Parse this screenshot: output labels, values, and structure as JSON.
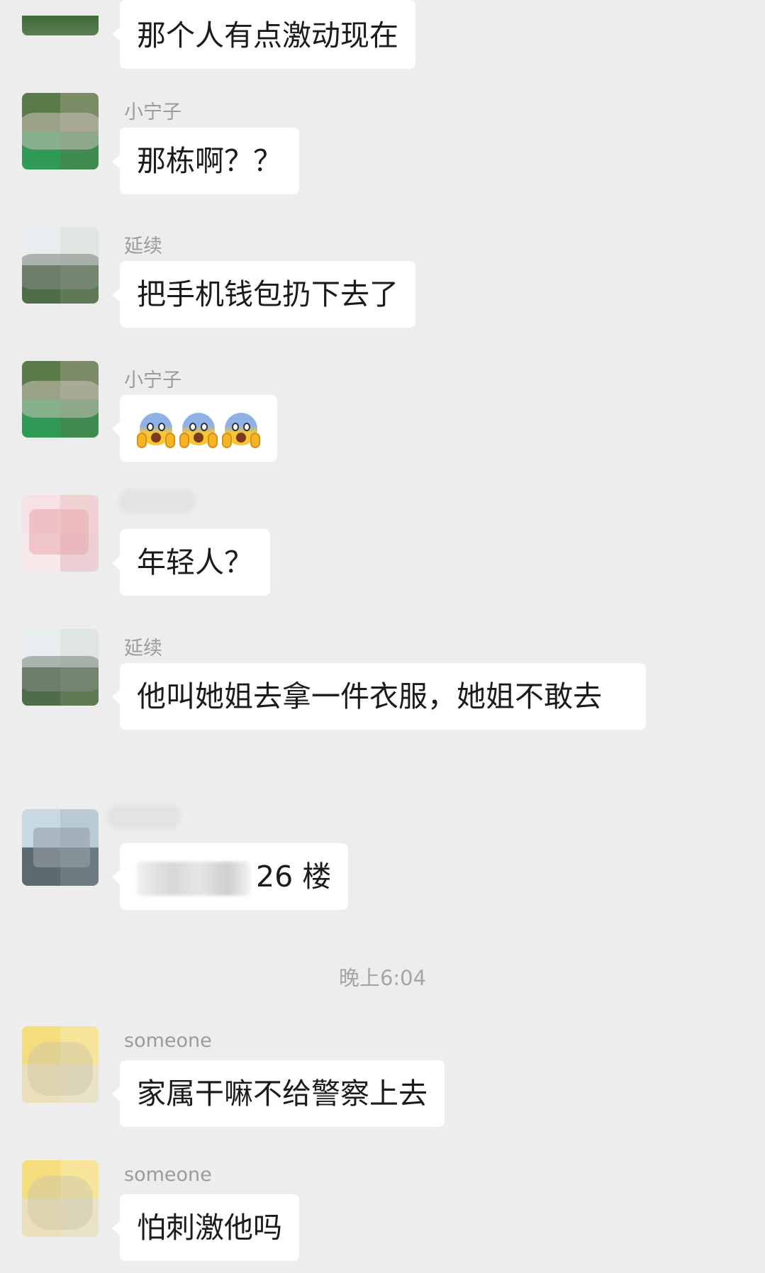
{
  "messages": [
    {
      "name": "",
      "text": "那个人有点激动现在"
    },
    {
      "name": "小宁子",
      "text": "那栋啊？？"
    },
    {
      "name": "延续",
      "text": "把手机钱包扔下去了"
    },
    {
      "name": "小宁子",
      "emoji": [
        "screaming-face",
        "screaming-face",
        "screaming-face"
      ]
    },
    {
      "name": "",
      "text": "年轻人？"
    },
    {
      "name": "延续",
      "text": "他叫她姐去拿一件衣服，她姐不敢去"
    },
    {
      "name": "",
      "text": "26 楼"
    },
    {
      "name": "someone",
      "text": "家属干嘛不给警察上去"
    },
    {
      "name": "someone",
      "text": "怕刺激他吗"
    }
  ],
  "timestamp": "晚上6:04"
}
